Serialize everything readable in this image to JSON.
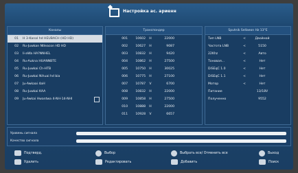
{
  "title": "Настройка ас. ариенн",
  "columns": {
    "channels": "Каналы",
    "frequencies": "Транспондер",
    "settings": "Sputnik Sellaeon Hz 13°E"
  },
  "channels": [
    {
      "num": "01",
      "name": "H 3-Kanal hd HEUBACH (HD HD)"
    },
    {
      "num": "02",
      "name": "Ru-Juwkan Ntleacon HD HD"
    },
    {
      "num": "03",
      "name": "Ii-aWa HA?NNHEL"
    },
    {
      "num": "04",
      "name": "Ru-Aukna HUANNBTE"
    },
    {
      "num": "05",
      "name": "Ru-Juwkai Ch-HTB"
    },
    {
      "num": "06",
      "name": "Ru-Juwkai Nihuai hd bia"
    },
    {
      "num": "07",
      "name": "Ju-Awkaai 4aH"
    },
    {
      "num": "08",
      "name": "Ru-Juwkai KAA"
    },
    {
      "num": "09",
      "name": "Ju-Awkai Hwantwa 4-NH-14-NHI"
    }
  ],
  "frequencies": [
    {
      "num": "001",
      "freq": "10602",
      "pol": "H",
      "sym": "22000"
    },
    {
      "num": "002",
      "freq": "10627",
      "pol": "H",
      "sym": "9087"
    },
    {
      "num": "003",
      "freq": "10832",
      "pol": "H",
      "sym": "9420"
    },
    {
      "num": "004",
      "freq": "10862",
      "pol": "H",
      "sym": "27500"
    },
    {
      "num": "005",
      "freq": "10750",
      "pol": "H",
      "sym": "30025"
    },
    {
      "num": "006",
      "freq": "10775",
      "pol": "H",
      "sym": "27100"
    },
    {
      "num": "007",
      "freq": "10787",
      "pol": "V",
      "sym": "6700"
    },
    {
      "num": "008",
      "freq": "10832",
      "pol": "H",
      "sym": "22000"
    },
    {
      "num": "009",
      "freq": "10858",
      "pol": "H",
      "sym": "27500"
    },
    {
      "num": "010",
      "freq": "10888",
      "pol": "H",
      "sym": "22000"
    },
    {
      "num": "011",
      "freq": "10928",
      "pol": "V",
      "sym": "6657"
    }
  ],
  "settings": [
    {
      "label": "Тип LNB",
      "arrow": "<",
      "value": "Двойной"
    },
    {
      "label": "Частота LNB",
      "arrow": "<",
      "value": "5150"
    },
    {
      "label": "22Khz",
      "arrow": "<",
      "value": "Авто"
    },
    {
      "label": "Тоновая...",
      "arrow": "<",
      "value": "Нет"
    },
    {
      "label": "DiSEqC 1.0",
      "arrow": "<",
      "value": "Нет"
    },
    {
      "label": "DiSEqC 1.1",
      "arrow": "<",
      "value": "Нет"
    },
    {
      "label": "Мотор",
      "arrow": "<",
      "value": "Нет"
    },
    {
      "label": "Питание",
      "arrow": "",
      "value": "13/18V"
    },
    {
      "label": "Полученно",
      "arrow": "",
      "value": "9552"
    }
  ],
  "signal": {
    "strength_label": "Уровень сигнала",
    "quality_label": "Качество сигнала"
  },
  "footer": {
    "confirm": "Подтверд.",
    "select": "Выбор",
    "select_all": "Выбрать все/ Отменить все",
    "exit": "Выход",
    "delete": "Удалить",
    "edit": "Редактировать",
    "add": "Добавить",
    "find": "Поиск"
  }
}
